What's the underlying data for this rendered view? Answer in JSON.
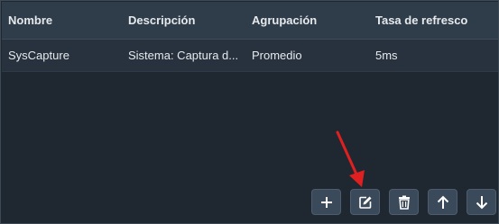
{
  "table": {
    "columns": [
      "Nombre",
      "Descripción",
      "Agrupación",
      "Tasa de refresco"
    ],
    "rows": [
      [
        "SysCapture",
        "Sistema: Captura d...",
        "Promedio",
        "5ms"
      ]
    ]
  },
  "toolbar": {
    "buttons": [
      {
        "name": "add-button",
        "icon": "plus-icon"
      },
      {
        "name": "edit-button",
        "icon": "edit-icon"
      },
      {
        "name": "delete-button",
        "icon": "trash-icon"
      },
      {
        "name": "move-up-button",
        "icon": "arrow-up-icon"
      },
      {
        "name": "move-down-button",
        "icon": "arrow-down-icon"
      }
    ]
  },
  "colors": {
    "background": "#1f2730",
    "header": "#2f3c4a",
    "row": "#27323e",
    "button": "#3b4a5a",
    "annotation_arrow": "#e02020"
  }
}
